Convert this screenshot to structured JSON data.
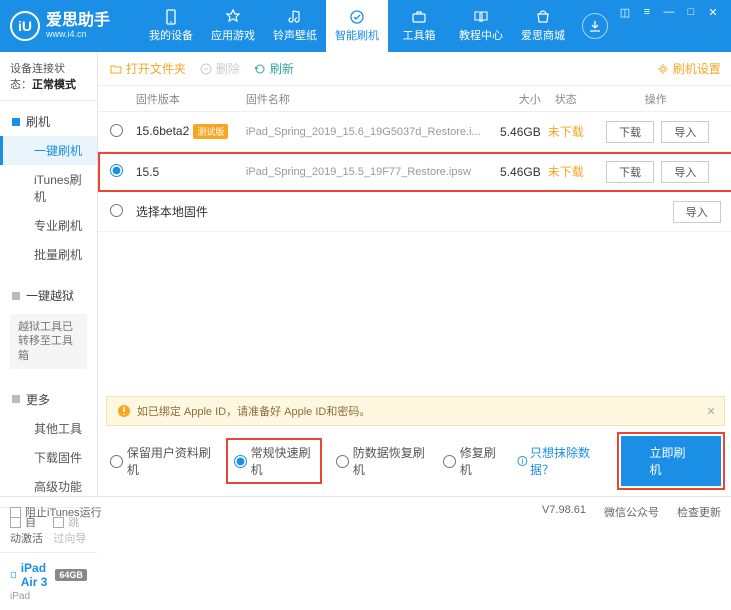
{
  "brand": {
    "title": "爱思助手",
    "url": "www.i4.cn",
    "logo_letter": "iU"
  },
  "win": {
    "skin": "◫",
    "pin": "≡",
    "min": "—",
    "max": "□",
    "close": "✕"
  },
  "nav": [
    {
      "label": "我的设备"
    },
    {
      "label": "应用游戏"
    },
    {
      "label": "铃声壁纸"
    },
    {
      "label": "智能刷机"
    },
    {
      "label": "工具箱"
    },
    {
      "label": "教程中心"
    },
    {
      "label": "爱思商城"
    }
  ],
  "conn_status": {
    "prefix": "设备连接状态：",
    "value": "正常模式"
  },
  "side": {
    "g1": {
      "head": "刷机",
      "items": [
        "一键刷机",
        "iTunes刷机",
        "专业刷机",
        "批量刷机"
      ]
    },
    "g2": {
      "head": "一键越狱",
      "note": "越狱工具已转移至工具箱"
    },
    "g3": {
      "head": "更多",
      "items": [
        "其他工具",
        "下载固件",
        "高级功能"
      ]
    },
    "chk1": "自动激活",
    "chk2": "跳过向导"
  },
  "device": {
    "name": "iPad Air 3",
    "badge": "64GB",
    "sub": "iPad"
  },
  "toolbar": {
    "open": "打开文件夹",
    "delete": "删除",
    "refresh": "刷新",
    "settings": "刷机设置"
  },
  "cols": {
    "ver": "固件版本",
    "name": "固件名称",
    "size": "大小",
    "status": "状态",
    "ops": "操作"
  },
  "rows": [
    {
      "ver": "15.6beta2",
      "beta": "测试版",
      "name": "iPad_Spring_2019_15.6_19G5037d_Restore.i...",
      "size": "5.46GB",
      "status": "未下载",
      "selected": false
    },
    {
      "ver": "15.5",
      "beta": "",
      "name": "iPad_Spring_2019_15.5_19F77_Restore.ipsw",
      "size": "5.46GB",
      "status": "未下载",
      "selected": true
    }
  ],
  "local_row": "选择本地固件",
  "btn": {
    "download": "下载",
    "import": "导入"
  },
  "warn": "如已绑定 Apple ID，请准备好 Apple ID和密码。",
  "modes": {
    "keep": "保留用户资料刷机",
    "normal": "常规快速刷机",
    "antirec": "防数据恢复刷机",
    "repair": "修复刷机",
    "help": "只想抹除数据？",
    "flash": "立即刷机"
  },
  "status": {
    "block_itunes": "阻止iTunes运行",
    "version": "V7.98.61",
    "wechat": "微信公众号",
    "update": "检查更新"
  }
}
